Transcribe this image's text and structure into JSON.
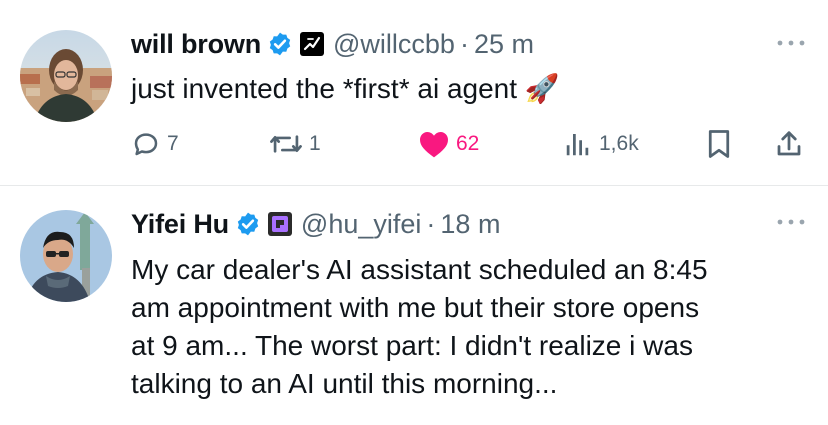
{
  "tweets": [
    {
      "name": "will brown",
      "handle": "@willccbb",
      "dot": "·",
      "time": "25 m",
      "text": "just invented the *first* ai agent",
      "emoji": "🚀",
      "counts": {
        "replies": "7",
        "retweets": "1",
        "likes": "62",
        "views": "1,6k"
      },
      "liked": true
    },
    {
      "name": "Yifei Hu",
      "handle": "@hu_yifei",
      "dot": "·",
      "time": "18 m",
      "text_lines": [
        "My car dealer's AI assistant scheduled an 8:45",
        "am appointment with me but their store opens",
        "at 9 am... The worst part: I didn't realize i was",
        "talking to an AI until this morning..."
      ]
    }
  ],
  "icons": {
    "verified": "verified-badge-icon",
    "affiliate": "affiliate-badge-icon",
    "more": "more-options-icon",
    "reply": "reply-icon",
    "retweet": "retweet-icon",
    "like": "heart-icon",
    "views": "views-icon",
    "bookmark": "bookmark-icon",
    "share": "share-icon"
  },
  "colors": {
    "accent": "#1d9bf0",
    "like": "#f91880",
    "muted": "#536471",
    "text": "#0f1419"
  }
}
